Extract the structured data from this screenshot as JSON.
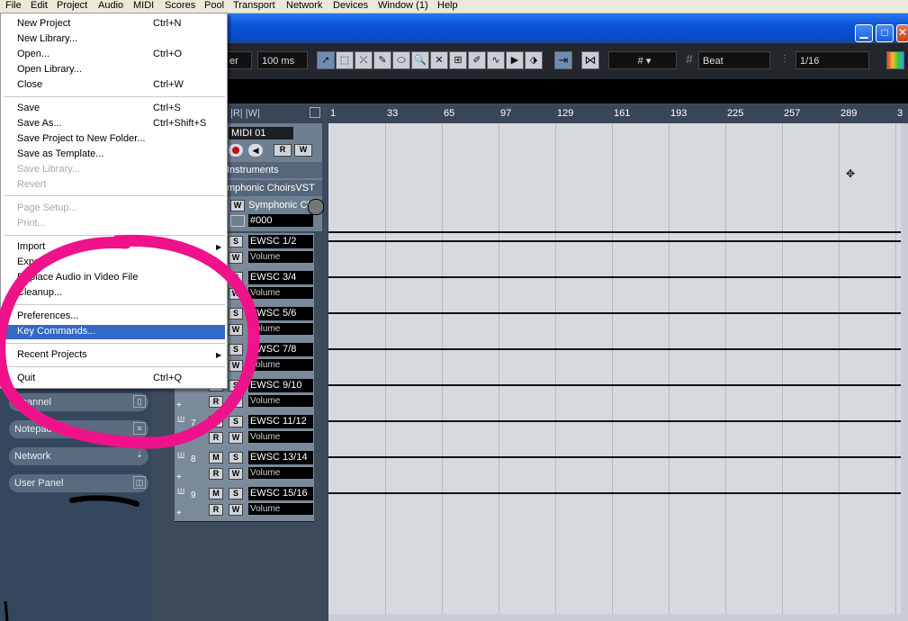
{
  "menubar": {
    "items": [
      "File",
      "Edit",
      "Project",
      "Audio",
      "MIDI",
      "Scores",
      "Pool",
      "Transport",
      "Network",
      "Devices",
      "Window (1)",
      "Help"
    ]
  },
  "window": {
    "minimize_glyph": "▁",
    "maximize_glyph": "□",
    "close_glyph": "✕"
  },
  "toolbar": {
    "snap_mode_partial": "er",
    "duration": "100 ms",
    "grid_glyph": "#",
    "grid_type": "Beat",
    "quantize": "1/16",
    "tools": [
      "arrow-icon",
      "range-icon",
      "split-icon",
      "glue-icon",
      "erase-icon",
      "zoom-icon",
      "mute-icon",
      "time-warp-icon",
      "draw-icon",
      "line-icon",
      "play-icon",
      "color-icon"
    ]
  },
  "file_menu": {
    "items": [
      {
        "label": "New Project",
        "shortcut": "Ctrl+N"
      },
      {
        "label": "New Library...",
        "shortcut": ""
      },
      {
        "label": "Open...",
        "shortcut": "Ctrl+O"
      },
      {
        "label": "Open Library...",
        "shortcut": ""
      },
      {
        "label": "Close",
        "shortcut": "Ctrl+W"
      },
      {
        "label": "Save",
        "shortcut": "Ctrl+S"
      },
      {
        "label": "Save As...",
        "shortcut": "Ctrl+Shift+S"
      },
      {
        "label": "Save Project to New Folder...",
        "shortcut": ""
      },
      {
        "label": "Save as Template...",
        "shortcut": ""
      },
      {
        "label": "Save Library...",
        "shortcut": ""
      },
      {
        "label": "Revert",
        "shortcut": ""
      },
      {
        "label": "Page Setup...",
        "shortcut": ""
      },
      {
        "label": "Print...",
        "shortcut": ""
      },
      {
        "label": "Import",
        "shortcut": ""
      },
      {
        "label": "Export",
        "shortcut": ""
      },
      {
        "label": "Replace Audio in Video File",
        "shortcut": ""
      },
      {
        "label": "Cleanup...",
        "shortcut": ""
      },
      {
        "label": "Preferences...",
        "shortcut": ""
      },
      {
        "label": "Key Commands...",
        "shortcut": ""
      },
      {
        "label": "Recent Projects",
        "shortcut": ""
      },
      {
        "label": "Quit",
        "shortcut": "Ctrl+Q"
      }
    ],
    "highlighted": "Key Commands...",
    "disabled": [
      "Save Library...",
      "Revert",
      "Page Setup...",
      "Print..."
    ]
  },
  "inspector": {
    "buttons": [
      "Channel",
      "Notepad",
      "Network",
      "User Panel"
    ]
  },
  "track_header": {
    "midi_name": "MIDI 01",
    "instruments_label": "Instruments",
    "instrument_partial": "mphonic ChoirsVST",
    "instrument_name": "Symphonic Choirs",
    "color_code": "#000"
  },
  "tracks": [
    {
      "number": "",
      "name": "EWSC 1/2",
      "param": "Volume"
    },
    {
      "number": "",
      "name": "EWSC 3/4",
      "param": "Volume"
    },
    {
      "number": "",
      "name": "EWSC 5/6",
      "param": "Volume"
    },
    {
      "number": "",
      "name": "EWSC 7/8",
      "param": "Volume"
    },
    {
      "number": "",
      "name": "EWSC 9/10",
      "param": "Volume"
    },
    {
      "number": "7",
      "name": "EWSC 11/12",
      "param": "Volume"
    },
    {
      "number": "8",
      "name": "EWSC 13/14",
      "param": "Volume"
    },
    {
      "number": "9",
      "name": "EWSC 15/16",
      "param": "Volume"
    }
  ],
  "ruler": {
    "ticks": [
      "1",
      "33",
      "65",
      "97",
      "129",
      "161",
      "193",
      "225",
      "257",
      "289",
      "3"
    ]
  },
  "colors": {
    "annotation": "#f0128a",
    "highlight": "#316ac5"
  }
}
